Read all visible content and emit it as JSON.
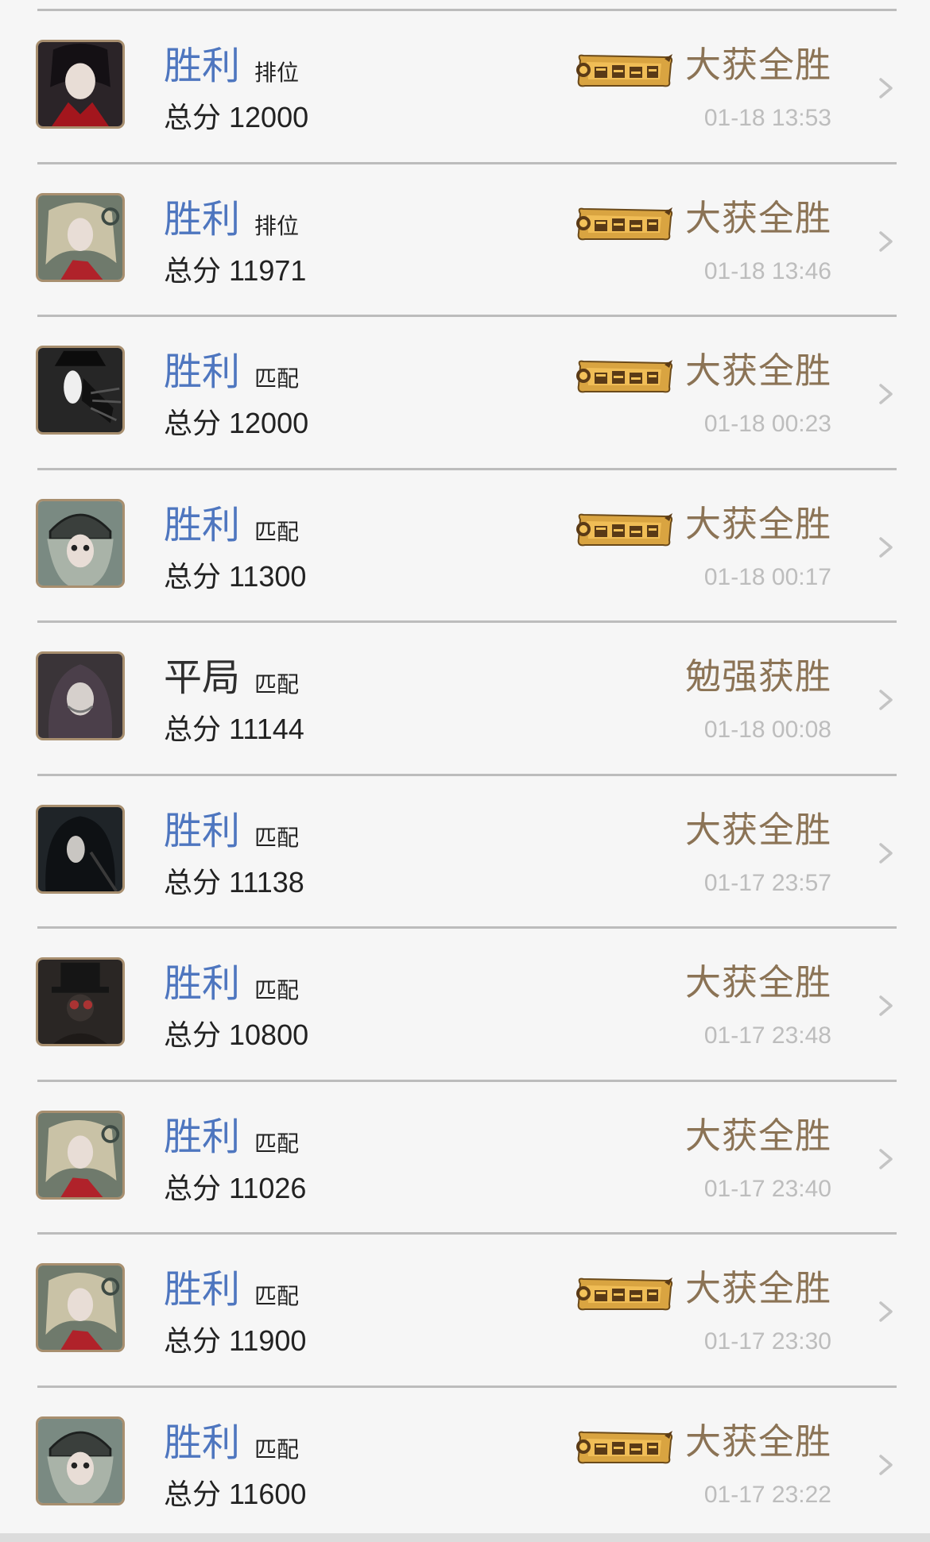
{
  "records": [
    {
      "result": "胜利",
      "draw": false,
      "mode": "排位",
      "score": "总分 12000",
      "badge": true,
      "outcome": "大获全胜",
      "time": "01-18 13:53",
      "avatar": "pale-lady-red-collar",
      "avatarColor": "#2b2428"
    },
    {
      "result": "胜利",
      "draw": false,
      "mode": "排位",
      "score": "总分 11971",
      "badge": true,
      "outcome": "大获全胜",
      "time": "01-18 13:46",
      "avatar": "blonde-red-dress",
      "avatarColor": "#6f7a6c"
    },
    {
      "result": "胜利",
      "draw": false,
      "mode": "匹配",
      "score": "总分 12000",
      "badge": true,
      "outcome": "大获全胜",
      "time": "01-18 00:23",
      "avatar": "masked-hat-claws",
      "avatarColor": "#262626"
    },
    {
      "result": "胜利",
      "draw": false,
      "mode": "匹配",
      "score": "总分 11300",
      "badge": true,
      "outcome": "大获全胜",
      "time": "01-18 00:17",
      "avatar": "helmet-girl",
      "avatarColor": "#7a8a82"
    },
    {
      "result": "平局",
      "draw": true,
      "mode": "匹配",
      "score": "总分 11144",
      "badge": false,
      "outcome": "勉强获胜",
      "time": "01-18 00:08",
      "avatar": "hooded-figure",
      "avatarColor": "#3a3438"
    },
    {
      "result": "胜利",
      "draw": false,
      "mode": "匹配",
      "score": "总分 11138",
      "badge": false,
      "outcome": "大获全胜",
      "time": "01-17 23:57",
      "avatar": "long-black-hair",
      "avatarColor": "#1f2428"
    },
    {
      "result": "胜利",
      "draw": false,
      "mode": "匹配",
      "score": "总分 10800",
      "badge": false,
      "outcome": "大获全胜",
      "time": "01-17 23:48",
      "avatar": "top-hat-mask",
      "avatarColor": "#2a2624"
    },
    {
      "result": "胜利",
      "draw": false,
      "mode": "匹配",
      "score": "总分 11026",
      "badge": false,
      "outcome": "大获全胜",
      "time": "01-17 23:40",
      "avatar": "blonde-red-dress",
      "avatarColor": "#6f7a6c"
    },
    {
      "result": "胜利",
      "draw": false,
      "mode": "匹配",
      "score": "总分 11900",
      "badge": true,
      "outcome": "大获全胜",
      "time": "01-17 23:30",
      "avatar": "blonde-red-dress",
      "avatarColor": "#6f7a6c"
    },
    {
      "result": "胜利",
      "draw": false,
      "mode": "匹配",
      "score": "总分 11600",
      "badge": true,
      "outcome": "大获全胜",
      "time": "01-17 23:22",
      "avatar": "helmet-girl",
      "avatarColor": "#7a8a82"
    }
  ],
  "colors": {
    "win": "#4e76bf",
    "draw": "#2f2f2f",
    "outcome": "#8b7355",
    "time": "#bdbdbd",
    "avatarBorder": "#a88f6f"
  }
}
